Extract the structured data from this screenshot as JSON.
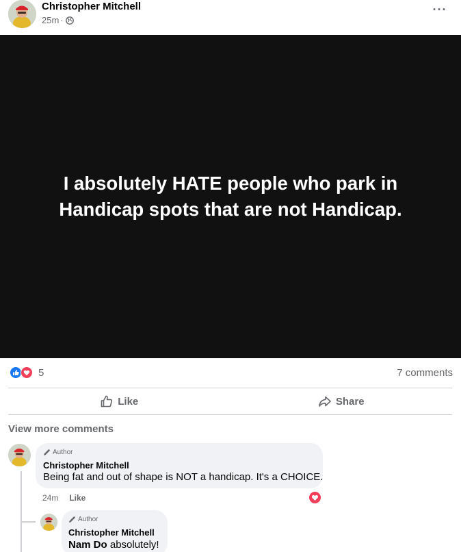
{
  "post": {
    "author": "Christopher Mitchell",
    "time": "25m",
    "meta_separator": "·",
    "more_label": "···",
    "text": "I absolutely HATE people who park in Handicap spots that are not Handicap.",
    "card_background": "#111111"
  },
  "reactions": {
    "types": [
      "like-icon",
      "love-icon"
    ],
    "count": "5",
    "comments_label": "7 comments"
  },
  "actions": {
    "like_label": "Like",
    "share_label": "Share"
  },
  "comments": {
    "view_more_label": "View more comments",
    "items": [
      {
        "badge": "Author",
        "name": "Christopher Mitchell",
        "text": "Being fat and out of shape is NOT a handicap. It's a CHOICE.",
        "time": "24m",
        "like_label": "Like",
        "reaction": "love-icon"
      },
      {
        "badge": "Author",
        "name": "Christopher Mitchell",
        "mention": "Nam Do",
        "text": "absolutely!"
      }
    ]
  },
  "colors": {
    "like_blue": "#1877f2",
    "love_red": "#f33e58",
    "muted_text": "#65676b",
    "bubble_bg": "#f0f2f5"
  }
}
